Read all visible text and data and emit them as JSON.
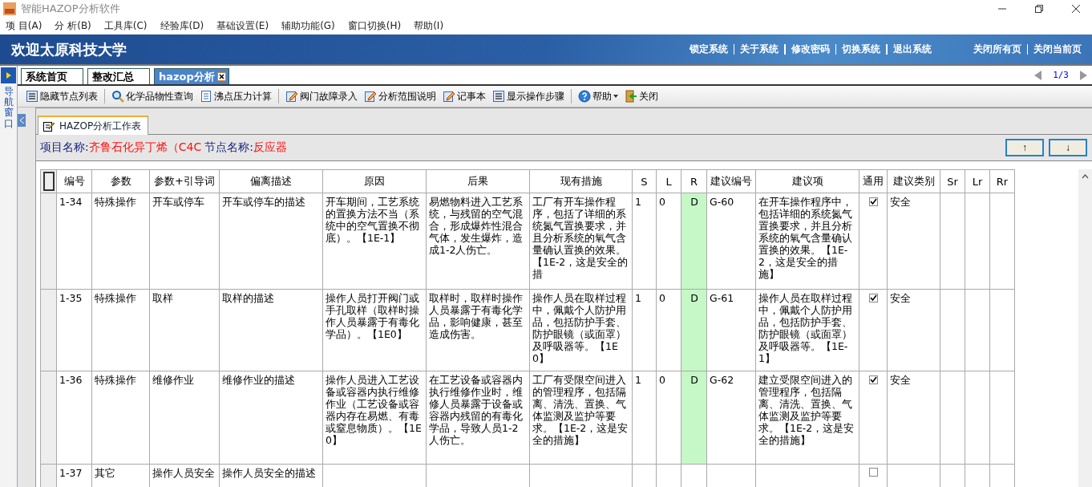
{
  "window": {
    "title": "智能HAZOP分析软件"
  },
  "menu": [
    "项 目(A)",
    "分 析(B)",
    "工具库(C)",
    "经验库(D)",
    "基础设置(E)",
    "辅助功能(G)",
    "窗口切换(H)",
    "帮助(I)"
  ],
  "banner": {
    "title": "欢迎太原科技大学",
    "links": [
      "锁定系统",
      "关于系统",
      "修改密码",
      "切换系统",
      "退出系统"
    ],
    "page_links": [
      "关闭所有页",
      "关闭当前页"
    ]
  },
  "nav": {
    "label": "导航窗口"
  },
  "tabs": [
    {
      "label": "系统首页",
      "selected": false
    },
    {
      "label": "整改汇总",
      "selected": false
    },
    {
      "label": "hazop分析",
      "selected": true
    }
  ],
  "pager": "1/3",
  "toolbar": [
    {
      "label": "隐藏节点列表",
      "kind": "list"
    },
    {
      "label": "化学品物性查询",
      "kind": "search"
    },
    {
      "label": "沸点压力计算",
      "kind": "doc"
    },
    {
      "label": "阀门故障录入",
      "kind": "pencil"
    },
    {
      "label": "分析范围说明",
      "kind": "pencil"
    },
    {
      "label": "记事本",
      "kind": "pencil"
    },
    {
      "label": "显示操作步骤",
      "kind": "list"
    },
    {
      "label": "帮助",
      "kind": "help",
      "dropdown": true
    },
    {
      "label": "关闭",
      "kind": "exit"
    }
  ],
  "worksheet_tab": {
    "label": "HAZOP分析工作表"
  },
  "project": {
    "label": "项目名称:",
    "value": "齐鲁石化异丁烯（C4C",
    "node_label": "节点名称:",
    "node_value": "反应器"
  },
  "sort_buttons": [
    "↑",
    "↓"
  ],
  "table": {
    "columns": [
      "编号",
      "参数",
      "参数+引导词",
      "偏离描述",
      "原因",
      "后果",
      "现有措施",
      "S",
      "L",
      "R",
      "建议编号",
      "建议项",
      "通用",
      "建议类别",
      "Sr",
      "Lr",
      "Rr"
    ],
    "rows": [
      {
        "id": "1-34",
        "param": "特殊操作",
        "guide": "开车或停车",
        "deviation": "开车或停车的描述",
        "cause": "开车期间，工艺系统的置换方法不当（系统中的空气置换不彻底）。【1E-1】",
        "consequence": "易燃物料进入工艺系统，与残留的空气混合，形成爆炸性混合气体，发生爆炸，造成1-2人伤亡。",
        "measures": "工厂有开车操作程序，包括了详细的系统氮气置换要求，并且分析系统的氧气含量确认置换的效果。【1E-2，这是安全的措",
        "s": "1",
        "l": "0",
        "r": "D",
        "color": "#c6f7c6",
        "advice_id": "G-60",
        "advice": "在开车操作程序中，包括详细的系统氮气置换要求，并且分析系统的氧气含量确认置换的效果。【1E-2，这是安全的措施】",
        "general": true,
        "category": "安全"
      },
      {
        "id": "1-35",
        "param": "特殊操作",
        "guide": "取样",
        "deviation": "取样的描述",
        "cause": "操作人员打开阀门或手孔取样（取样时操作人员暴露于有毒化学品）。【1E0】",
        "consequence": "取样时，取样时操作人员暴露于有毒化学品，影响健康，甚至造成伤害。",
        "measures": "操作人员在取样过程中，佩戴个人防护用品，包括防护手套、防护眼镜（或面罩）及呼吸器等。【1E0】",
        "s": "1",
        "l": "0",
        "r": "D",
        "color": "#c6f7c6",
        "advice_id": "G-61",
        "advice": "操作人员在取样过程中，佩戴个人防护用品，包括防护手套、防护眼镜（或面罩）及呼吸器等。【1E-1】",
        "general": true,
        "category": "安全"
      },
      {
        "id": "1-36",
        "param": "特殊操作",
        "guide": "维修作业",
        "deviation": "维修作业的描述",
        "cause": "操作人员进入工艺设备或容器内执行维修作业（工艺设备或容器内存在易燃、有毒或窒息物质）。【1E0】",
        "consequence": "在工艺设备或容器内执行维修作业时，维修人员暴露于设备或容器内残留的有毒化学品，导致人员1-2人伤亡。",
        "measures": "工厂有受限空间进入的管理程序，包括隔离、清洗、置换、气体监测及监护等要求。【1E-2，这是安全的措施】",
        "s": "1",
        "l": "0",
        "r": "D",
        "color": "#c6f7c6",
        "advice_id": "G-62",
        "advice": "建立受限空间进入的管理程序，包括隔离、清洗、置换、气体监测及监护等要求。【1E-2，这是安全的措施】",
        "general": true,
        "category": "安全"
      },
      {
        "id": "1-37",
        "param": "其它",
        "guide": "操作人员安全",
        "deviation": "操作人员安全的描述",
        "general": false
      }
    ]
  }
}
